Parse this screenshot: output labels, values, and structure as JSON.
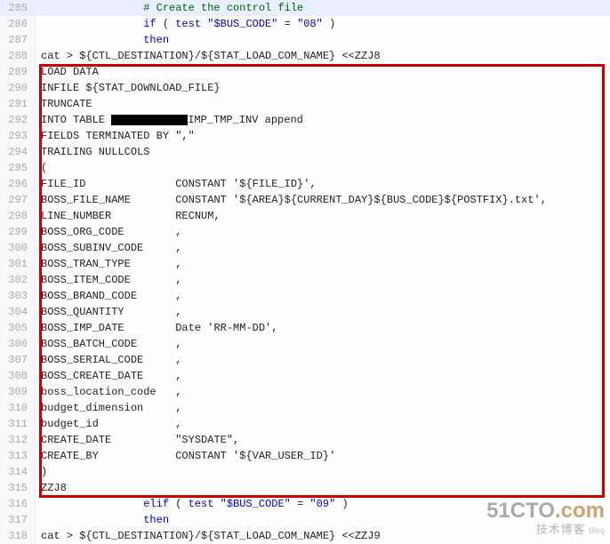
{
  "watermark": {
    "main1": "51CTO",
    "main2": ".com",
    "sub": "技术博客",
    "blog": "Blog"
  },
  "lines": [
    {
      "n": 285,
      "cls": "ln285",
      "indent": 16,
      "segs": [
        {
          "t": "# Create the control file",
          "c": "comment"
        }
      ]
    },
    {
      "n": 286,
      "indent": 16,
      "segs": [
        {
          "t": "if",
          "c": "kw"
        },
        {
          "t": " ( "
        },
        {
          "t": "test",
          "c": "kw"
        },
        {
          "t": " "
        },
        {
          "t": "\"$BUS_CODE\"",
          "c": "str"
        },
        {
          "t": " = "
        },
        {
          "t": "\"08\"",
          "c": "str"
        },
        {
          "t": " )"
        }
      ]
    },
    {
      "n": 287,
      "indent": 16,
      "segs": [
        {
          "t": "then",
          "c": "kw"
        }
      ]
    },
    {
      "n": 288,
      "indent": 0,
      "segs": [
        {
          "t": "cat > ${CTL_DESTINATION}/${STAT_LOAD_COM_NAME} <<ZZJ8"
        }
      ]
    },
    {
      "n": 289,
      "indent": 0,
      "segs": [
        {
          "t": "LOAD DATA"
        }
      ]
    },
    {
      "n": 290,
      "indent": 0,
      "segs": [
        {
          "t": "INFILE ${STAT_DOWNLOAD_FILE}"
        }
      ]
    },
    {
      "n": 291,
      "indent": 0,
      "segs": [
        {
          "t": "TRUNCATE"
        }
      ]
    },
    {
      "n": 292,
      "indent": 0,
      "segs": [
        {
          "t": "INTO TABLE "
        },
        {
          "redact": true
        },
        {
          "t": "IMP_TMP_INV append"
        }
      ]
    },
    {
      "n": 293,
      "indent": 0,
      "segs": [
        {
          "t": "FIELDS TERMINATED BY \",\""
        }
      ]
    },
    {
      "n": 294,
      "indent": 0,
      "segs": [
        {
          "t": "TRAILING NULLCOLS"
        }
      ]
    },
    {
      "n": 295,
      "indent": 0,
      "segs": [
        {
          "t": "("
        }
      ]
    },
    {
      "n": 296,
      "indent": 0,
      "col1": "FILE_ID",
      "col2": "CONSTANT '${FILE_ID}',"
    },
    {
      "n": 297,
      "indent": 0,
      "col1": "BOSS_FILE_NAME",
      "col2": "CONSTANT '${AREA}${CURRENT_DAY}${BUS_CODE}${POSTFIX}.txt',"
    },
    {
      "n": 298,
      "indent": 0,
      "col1": "LINE_NUMBER",
      "col2": "RECNUM,"
    },
    {
      "n": 299,
      "indent": 0,
      "col1": "BOSS_ORG_CODE",
      "col2": ","
    },
    {
      "n": 300,
      "indent": 0,
      "col1": "BOSS_SUBINV_CODE",
      "col2": ","
    },
    {
      "n": 301,
      "indent": 0,
      "col1": "BOSS_TRAN_TYPE",
      "col2": ","
    },
    {
      "n": 302,
      "indent": 0,
      "col1": "BOSS_ITEM_CODE",
      "col2": ","
    },
    {
      "n": 303,
      "indent": 0,
      "col1": "BOSS_BRAND_CODE",
      "col2": ","
    },
    {
      "n": 304,
      "indent": 0,
      "col1": "BOSS_QUANTITY",
      "col2": ","
    },
    {
      "n": 305,
      "indent": 0,
      "col1": "BOSS_IMP_DATE",
      "col2": "Date 'RR-MM-DD',"
    },
    {
      "n": 306,
      "indent": 0,
      "col1": "BOSS_BATCH_CODE",
      "col2": ","
    },
    {
      "n": 307,
      "indent": 0,
      "col1": "BOSS_SERIAL_CODE",
      "col2": ","
    },
    {
      "n": 308,
      "indent": 0,
      "col1": "BOSS_CREATE_DATE",
      "col2": ","
    },
    {
      "n": 309,
      "indent": 0,
      "col1": "boss_location_code",
      "col2": ","
    },
    {
      "n": 310,
      "indent": 0,
      "col1": "budget_dimension",
      "col2": ","
    },
    {
      "n": 311,
      "indent": 0,
      "col1": "budget_id",
      "col2": ","
    },
    {
      "n": 312,
      "indent": 0,
      "col1": "CREATE_DATE",
      "col2": "\"SYSDATE\","
    },
    {
      "n": 313,
      "indent": 0,
      "col1": "CREATE_BY",
      "col2": "CONSTANT '${VAR_USER_ID}'"
    },
    {
      "n": 314,
      "indent": 0,
      "segs": [
        {
          "t": ")"
        }
      ]
    },
    {
      "n": 315,
      "indent": 0,
      "segs": [
        {
          "t": "ZZJ8"
        }
      ]
    },
    {
      "n": 316,
      "indent": 16,
      "segs": [
        {
          "t": "elif",
          "c": "kw"
        },
        {
          "t": " ( "
        },
        {
          "t": "test",
          "c": "kw"
        },
        {
          "t": " "
        },
        {
          "t": "\"$BUS_CODE\"",
          "c": "str"
        },
        {
          "t": " = "
        },
        {
          "t": "\"09\"",
          "c": "str"
        },
        {
          "t": " )"
        }
      ]
    },
    {
      "n": 317,
      "indent": 16,
      "segs": [
        {
          "t": "then",
          "c": "kw"
        }
      ]
    },
    {
      "n": 318,
      "indent": 0,
      "segs": [
        {
          "t": "cat > ${CTL_DESTINATION}/${STAT_LOAD_COM_NAME} <<ZZJ9"
        }
      ]
    }
  ]
}
